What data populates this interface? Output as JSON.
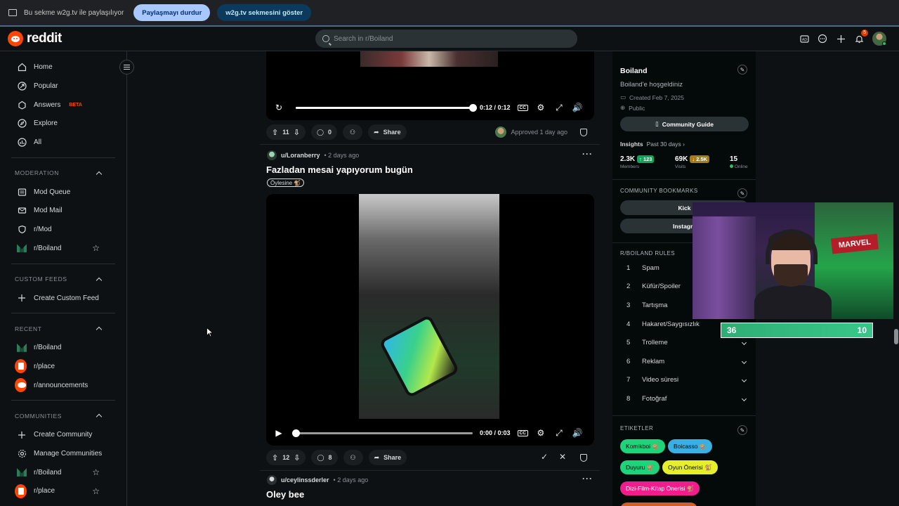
{
  "share_bar": {
    "text": "Bu sekme w2g.tv ile paylaşılıyor",
    "stop_label": "Paylaşmayı durdur",
    "show_label": "w2g.tv sekmesini göster"
  },
  "header": {
    "logo_text": "reddit",
    "search_placeholder": "Search in r/Boiland",
    "notification_count": "5"
  },
  "sidebar": {
    "main": [
      {
        "label": "Home",
        "icon": "home-icon"
      },
      {
        "label": "Popular",
        "icon": "popular-icon"
      },
      {
        "label": "Answers",
        "icon": "answers-icon",
        "badge": "BETA"
      },
      {
        "label": "Explore",
        "icon": "explore-icon"
      },
      {
        "label": "All",
        "icon": "all-icon"
      }
    ],
    "moderation_title": "MODERATION",
    "moderation": [
      {
        "label": "Mod Queue"
      },
      {
        "label": "Mod Mail"
      },
      {
        "label": "r/Mod"
      },
      {
        "label": "r/Boiland"
      }
    ],
    "custom_feeds_title": "CUSTOM FEEDS",
    "create_custom_feed": "Create Custom Feed",
    "recent_title": "RECENT",
    "recent": [
      {
        "label": "r/Boiland"
      },
      {
        "label": "r/place"
      },
      {
        "label": "r/announcements"
      }
    ],
    "communities_title": "COMMUNITIES",
    "create_community": "Create Community",
    "manage_communities": "Manage Communities",
    "communities": [
      {
        "label": "r/Boiland"
      },
      {
        "label": "r/place"
      }
    ]
  },
  "post1": {
    "time": "0:12 / 0:12",
    "progress": 1.0,
    "upvotes": "11",
    "comments": "0",
    "share": "Share",
    "approved": "Approved 1 day ago"
  },
  "post2": {
    "user": "u/Loranberry",
    "ago": "• 2 days ago",
    "title": "Fazladan mesai yapıyorum bugün",
    "flair": "Öylesine 🐒",
    "time": "0:00 / 0:03",
    "progress": 0.0,
    "upvotes": "12",
    "comments": "8",
    "share": "Share"
  },
  "post3": {
    "user": "u/ceylinssderler",
    "ago": "• 2 days ago",
    "title": "Oley bee"
  },
  "community": {
    "name": "Boiland",
    "description": "Boiland'e hoşgeldiniz",
    "created": "Created Feb 7, 2025",
    "visibility": "Public",
    "guide_label": "Community Guide",
    "insights_label": "Insights",
    "insights_period": "Past 30 days ›",
    "members": "2.3K",
    "members_change": "↑ 123",
    "members_label": "Members",
    "visits": "69K",
    "visits_change": "↓ 2.5K",
    "visits_label": "Visits",
    "online": "15",
    "online_label": "Online",
    "bookmarks_title": "COMMUNITY BOOKMARKS",
    "bookmarks": [
      "Kick",
      "Instagra"
    ],
    "rules_title": "R/BOILAND RULES",
    "rules": [
      {
        "n": "1",
        "label": "Spam"
      },
      {
        "n": "2",
        "label": "Küfür/Spoiler"
      },
      {
        "n": "3",
        "label": "Tartışma"
      },
      {
        "n": "4",
        "label": "Hakaret/Saygısızlık"
      },
      {
        "n": "5",
        "label": "Trolleme"
      },
      {
        "n": "6",
        "label": "Reklam"
      },
      {
        "n": "7",
        "label": "Video süresi"
      },
      {
        "n": "8",
        "label": "Fotoğraf"
      }
    ],
    "tags_title": "ETIKETLER",
    "tags": [
      {
        "label": "Komikboi 🐒",
        "color": "#1ed47a"
      },
      {
        "label": "Boicasso 🐒",
        "color": "#37b0e4"
      },
      {
        "label": "Duyuru 🐒",
        "color": "#1ed47a"
      },
      {
        "label": "Oyun Önerisi 🐒",
        "color": "#e4ee2a"
      },
      {
        "label": "Dizi-Film-Kitap Önerisi 🐒",
        "color": "#f21d8c"
      }
    ]
  },
  "stream_overlay": {
    "score_left": "36",
    "score_right": "10",
    "sign_text": "MARVEL"
  }
}
